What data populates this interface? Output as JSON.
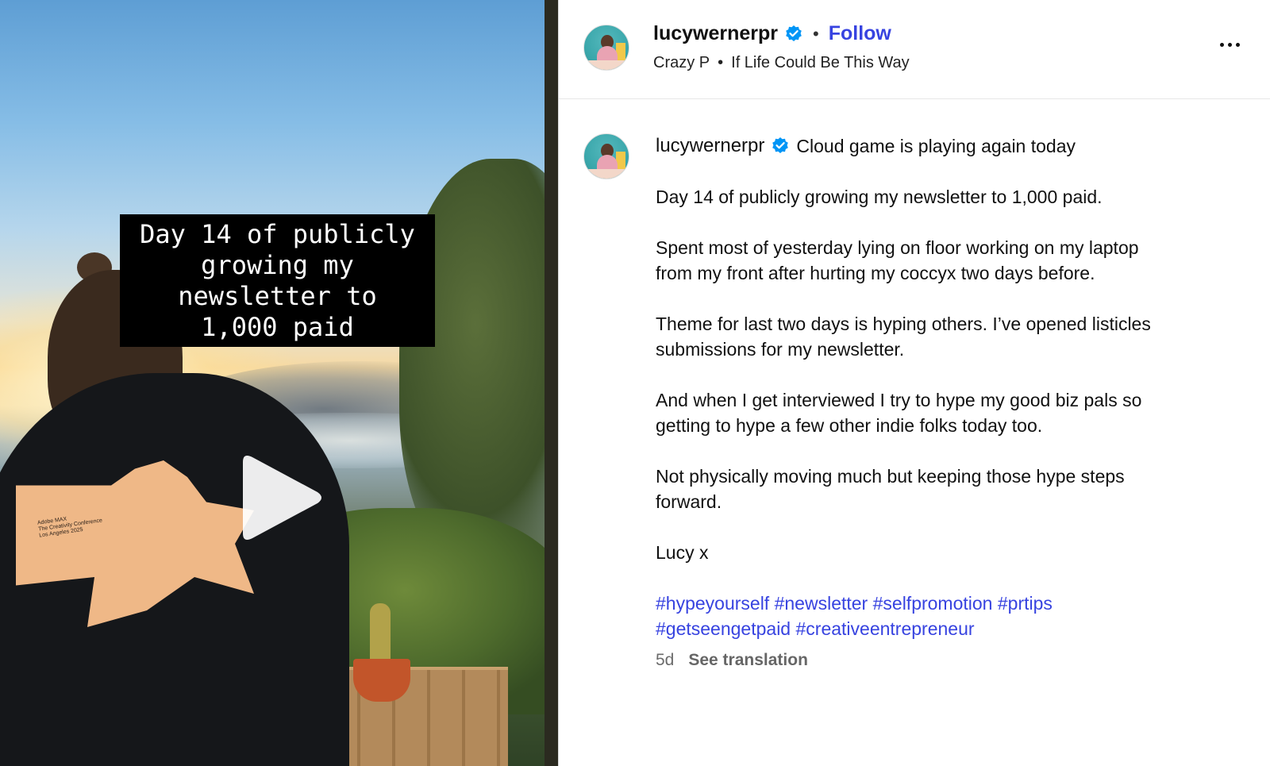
{
  "media": {
    "overlay_caption": "Day 14 of publicly\ngrowing my\nnewsletter to\n1,000 paid",
    "hoodie_print_text": "Adobe MAX\nThe Creativity Conference\nLos Angeles 2025",
    "play_icon": "play-icon"
  },
  "header": {
    "username": "lucywernerpr",
    "separator": "•",
    "follow_label": "Follow",
    "audio_artist": "Crazy P",
    "audio_separator": "•",
    "audio_track": "If Life Could Be This Way",
    "more_icon": "more-options-icon",
    "verified_icon": "verified-badge-icon"
  },
  "post": {
    "username": "lucywernerpr",
    "caption_lead": "Cloud game is playing again today",
    "paragraphs": [
      "Day 14 of publicly growing my newsletter to 1,000 paid.",
      "Spent most of yesterday lying on floor working on my laptop\nfrom my front after hurting my coccyx two days before.",
      "Theme for last two days is hyping others. I’ve opened listicles\nsubmissions for my newsletter.",
      "And when I get interviewed I try to hype my good biz pals so\ngetting to hype a few other indie folks today too.",
      "Not physically moving much but keeping those hype steps\nforward.",
      "Lucy x"
    ],
    "hashtags": [
      "#hypeyourself",
      "#newsletter",
      "#selfpromotion",
      "#prtips",
      "#getseengetpaid",
      "#creativeentrepreneur"
    ],
    "time_ago": "5d",
    "see_translation": "See translation"
  },
  "colors": {
    "link_blue": "#3743e0",
    "verified_blue": "#0095f6",
    "meta_gray": "#6b6b6b"
  }
}
